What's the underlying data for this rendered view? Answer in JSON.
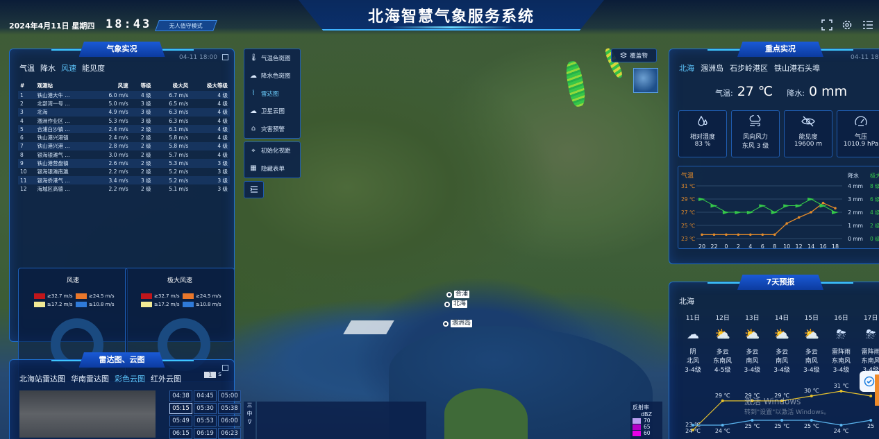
{
  "header": {
    "title": "北海智慧气象服务系统",
    "date": "2024年4月11日 星期四",
    "time": "18:43",
    "mode": "无人值守模式"
  },
  "weather_panel": {
    "title": "气象实况",
    "timestamp": "04-11 18:00",
    "tabs": [
      "气温",
      "降水",
      "风速",
      "能见度"
    ],
    "active_tab": "风速",
    "columns": [
      "#",
      "观测站",
      "风速",
      "等级",
      "极大风",
      "极大等级"
    ],
    "rows": [
      [
        "1",
        "铁山港大牛 ...",
        "6.0 m/s",
        "4 级",
        "6.7 m/s",
        "4 级"
      ],
      [
        "2",
        "北部湾一号 ...",
        "5.0 m/s",
        "3 级",
        "6.5 m/s",
        "4 级"
      ],
      [
        "3",
        "北海",
        "4.9 m/s",
        "3 级",
        "6.3 m/s",
        "4 级"
      ],
      [
        "4",
        "涠洲作业区 ...",
        "5.3 m/s",
        "3 级",
        "6.3 m/s",
        "4 级"
      ],
      [
        "5",
        "合浦白沙镇 ...",
        "2.4 m/s",
        "2 级",
        "6.1 m/s",
        "4 级"
      ],
      [
        "6",
        "铁山港兴港镇",
        "2.4 m/s",
        "2 级",
        "5.8 m/s",
        "4 级"
      ],
      [
        "7",
        "铁山港兴港 ...",
        "2.8 m/s",
        "2 级",
        "5.8 m/s",
        "4 级"
      ],
      [
        "8",
        "银海银滩气 ...",
        "3.0 m/s",
        "2 级",
        "5.7 m/s",
        "4 级"
      ],
      [
        "9",
        "铁山港营盘镇",
        "2.6 m/s",
        "2 级",
        "5.3 m/s",
        "3 级"
      ],
      [
        "10",
        "银海银滩南瀛",
        "2.2 m/s",
        "2 级",
        "5.2 m/s",
        "3 级"
      ],
      [
        "11",
        "银海侨港气 ...",
        "3.4 m/s",
        "3 级",
        "5.2 m/s",
        "3 级"
      ],
      [
        "12",
        "海城区高德 ...",
        "2.2 m/s",
        "2 级",
        "5.1 m/s",
        "3 级"
      ]
    ],
    "wind_box": {
      "title": "风速",
      "legend": [
        {
          "label": "≥32.7 m/s",
          "color": "#c0161b"
        },
        {
          "label": "≥24.5 m/s",
          "color": "#e9772b"
        },
        {
          "label": "≥17.2 m/s",
          "color": "#f2ea95"
        },
        {
          "label": "≥10.8 m/s",
          "color": "#2f7ad8"
        }
      ]
    },
    "gust_box": {
      "title": "极大风速",
      "legend": [
        {
          "label": "≥32.7 m/s",
          "color": "#c0161b"
        },
        {
          "label": "≥24.5 m/s",
          "color": "#e9772b"
        },
        {
          "label": "≥17.2 m/s",
          "color": "#f2ea95"
        },
        {
          "label": "≥10.8 m/s",
          "color": "#2f7ad8"
        }
      ]
    }
  },
  "radar_panel": {
    "title": "雷达图、云图",
    "tabs": [
      "北海站雷达图",
      "华南雷达图",
      "彩色云图",
      "红外云图"
    ],
    "active_tab": "彩色云图",
    "speed_value": "1",
    "speed_unit": "s",
    "times": [
      "04:38",
      "04:45",
      "05:00",
      "05:15",
      "05:30",
      "05:38",
      "05:49",
      "05:53",
      "06:00",
      "06:15",
      "06:19",
      "06:23"
    ],
    "selected_time": "05:15"
  },
  "toolbar": {
    "items": [
      {
        "label": "气温色斑图",
        "icon": "thermometer-icon"
      },
      {
        "label": "降水色斑图",
        "icon": "rain-cloud-icon"
      },
      {
        "label": "雷达图",
        "icon": "radar-icon"
      },
      {
        "label": "卫星云图",
        "icon": "cloud-icon"
      },
      {
        "label": "灾害预警",
        "icon": "warning-house-icon"
      }
    ],
    "active": "雷达图",
    "items2": [
      {
        "label": "初始化视距",
        "icon": "reset-view-icon"
      },
      {
        "label": "隐藏表单",
        "icon": "hide-forms-icon"
      }
    ],
    "cover_label": "覆盖物"
  },
  "map": {
    "markers": [
      "合浦",
      "北海",
      "涠洲岛"
    ],
    "vbar_chars": [
      "三",
      "中",
      "∇"
    ]
  },
  "reflectivity": {
    "title": "反射率",
    "unit": "dBZ",
    "levels": [
      {
        "value": "70",
        "color": "#b99cf0"
      },
      {
        "value": "65",
        "color": "#b400c8"
      },
      {
        "value": "60",
        "color": "#e800e6"
      }
    ]
  },
  "focus_panel": {
    "title": "重点实况",
    "timestamp": "04-11 18",
    "locations": [
      "北海",
      "涠洲岛",
      "石步岭港区",
      "铁山港石头埠"
    ],
    "active_location": "北海",
    "temp_label": "气温:",
    "temp_value": "27 ℃",
    "rain_label": "降水:",
    "rain_value": "0 mm",
    "cards": [
      {
        "label": "相对湿度",
        "value": "83 %",
        "icon": "humidity-icon"
      },
      {
        "label": "风向风力",
        "value": "东风 3 级",
        "icon": "wind-cloud-icon"
      },
      {
        "label": "能见度",
        "value": "19600 m",
        "icon": "visibility-off-icon"
      },
      {
        "label": "气压",
        "value": "1010.9 hPa",
        "icon": "gauge-icon"
      }
    ]
  },
  "chart_data": [
    {
      "type": "line",
      "left_title": "气温",
      "right_title": "降水",
      "right_title2": "极大风",
      "x": [
        "20",
        "22",
        "0",
        "2",
        "4",
        "6",
        "8",
        "10",
        "12",
        "14",
        "16",
        "18"
      ],
      "y_left_ticks": [
        "31 ℃",
        "29 ℃",
        "27 ℃",
        "25 ℃",
        "23 ℃"
      ],
      "y_right_ticks": [
        "4 mm",
        "3 mm",
        "2 mm",
        "1 mm",
        "0 mm"
      ],
      "y_right2_ticks": [
        "8 级",
        "6 级",
        "4 级",
        "2 级",
        "0 级"
      ],
      "ylim_temp": [
        23,
        31
      ],
      "ylim_rain": [
        0,
        4
      ],
      "ylim_gust": [
        0,
        8
      ],
      "series": [
        {
          "name": "气温",
          "color": "#e48b2a",
          "values": [
            23.6,
            23.6,
            23.6,
            23.6,
            23.6,
            23.6,
            23.6,
            25.3,
            26.2,
            27.0,
            28.4,
            27.6
          ]
        },
        {
          "name": "极大风",
          "color": "#35c84a",
          "values": [
            6,
            5,
            4,
            4,
            4,
            5,
            4,
            5,
            5,
            6,
            5,
            4
          ],
          "marker": "wind-arrow"
        }
      ]
    },
    {
      "type": "line",
      "x": [
        "11日",
        "12日",
        "13日",
        "14日",
        "15日",
        "16日",
        "17日"
      ],
      "series": [
        {
          "name": "最高",
          "color": "#e6c12e",
          "values": [
            23,
            29,
            29,
            29,
            30,
            31,
            30
          ]
        },
        {
          "name": "最低",
          "color": "#5cb6f0",
          "values": [
            24,
            24,
            25,
            25,
            25,
            24,
            25
          ]
        }
      ]
    }
  ],
  "forecast_panel": {
    "title": "7天预报",
    "location": "北海",
    "days": [
      {
        "day": "11日",
        "weather": "阴",
        "wind_dir": "北风",
        "wind_lv": "3-4级",
        "high": "23 ℃",
        "low": "24 ℃",
        "icon": "overcast-icon"
      },
      {
        "day": "12日",
        "weather": "多云",
        "wind_dir": "东南风",
        "wind_lv": "4-5级",
        "high": "29 ℃",
        "low": "24 ℃",
        "icon": "partly-cloudy-icon"
      },
      {
        "day": "13日",
        "weather": "多云",
        "wind_dir": "南风",
        "wind_lv": "3-4级",
        "high": "29 ℃",
        "low": "25 ℃",
        "icon": "partly-cloudy-icon"
      },
      {
        "day": "14日",
        "weather": "多云",
        "wind_dir": "南风",
        "wind_lv": "3-4级",
        "high": "29 ℃",
        "low": "25 ℃",
        "icon": "partly-cloudy-icon"
      },
      {
        "day": "15日",
        "weather": "多云",
        "wind_dir": "南风",
        "wind_lv": "3-4级",
        "high": "30 ℃",
        "low": "25 ℃",
        "icon": "partly-cloudy-icon"
      },
      {
        "day": "16日",
        "weather": "雷阵雨",
        "wind_dir": "东南风",
        "wind_lv": "3-4级",
        "high": "31 ℃",
        "low": "24 ℃",
        "icon": "thunderstorm-icon"
      },
      {
        "day": "17日",
        "weather": "雷阵雨",
        "wind_dir": "东南风",
        "wind_lv": "3-4级",
        "high": "",
        "low": "25",
        "icon": "thunderstorm-icon"
      }
    ]
  },
  "watermark": {
    "line1": "激活 Windows",
    "line2": "转到\"设置\"以激活 Windows。"
  }
}
